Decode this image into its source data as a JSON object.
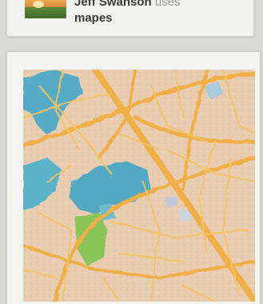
{
  "header_card": {
    "title_bold": "Jeff Swanson",
    "title_muted": "uses",
    "title_line2": "mapes",
    "thumbnail_icon": "landscape-thumbnail-icon"
  },
  "map_card": {
    "image_icon": "watercolor-map-image",
    "colors": {
      "paper": "#e9cdb0",
      "water": "#3fa6c4",
      "road": "#f2b43a",
      "park": "#7cc24a"
    }
  }
}
